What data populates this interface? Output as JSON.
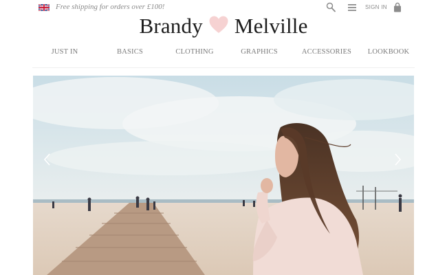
{
  "topbar": {
    "flag_icon": "uk-flag-icon",
    "promo_text": "Free shipping for orders over £100!",
    "search_icon": "search-icon",
    "menu_icon": "menu-icon",
    "signin_label": "SIGN IN",
    "bag_icon": "shopping-bag-icon"
  },
  "brand": {
    "name_left": "Brandy",
    "name_right": "Melville",
    "heart_icon": "heart-icon",
    "heart_color": "#f6d2d2"
  },
  "nav": {
    "items": [
      {
        "label": "JUST IN"
      },
      {
        "label": "BASICS"
      },
      {
        "label": "CLOTHING"
      },
      {
        "label": "GRAPHICS"
      },
      {
        "label": "ACCESSORIES"
      },
      {
        "label": "LOOKBOOK"
      }
    ]
  },
  "hero": {
    "slide_image": "beach-photo-girl-on-boardwalk",
    "prev_icon": "chevron-left-icon",
    "next_icon": "chevron-right-icon"
  },
  "colors": {
    "text_dark": "#1c1c1c",
    "text_muted": "#7a7a7a",
    "promo_text": "#888888",
    "divider": "#efefef"
  }
}
